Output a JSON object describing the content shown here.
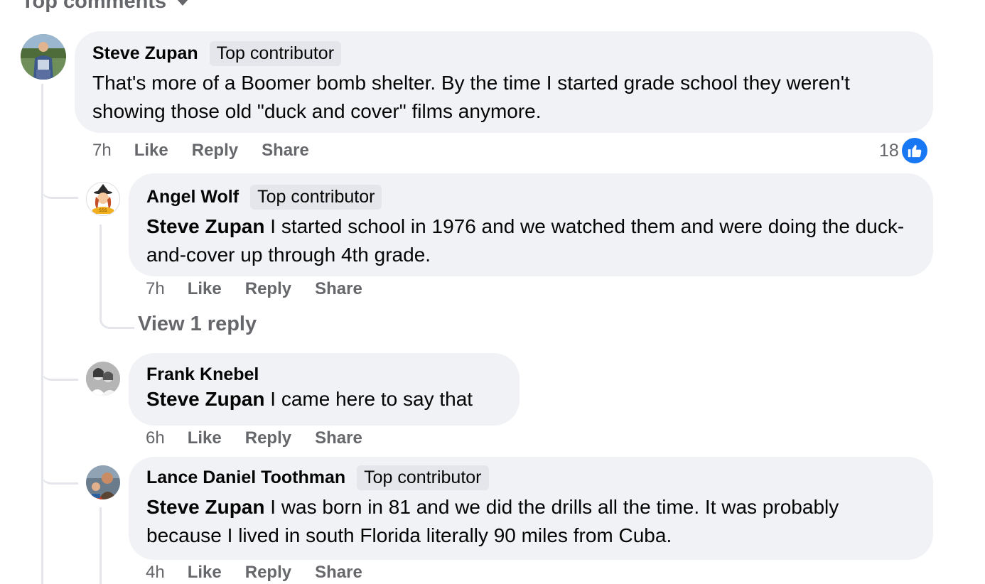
{
  "header": {
    "label": "Top comments"
  },
  "comments": [
    {
      "author": "Steve Zupan",
      "badge": "Top contributor",
      "text": "That's more of a Boomer bomb shelter. By the time I started grade school they weren't showing those old \"duck and cover\" films anymore.",
      "time": "7h",
      "like_label": "Like",
      "reply_label": "Reply",
      "share_label": "Share",
      "reaction_count": "18",
      "avatar_icon": "avatar-photo"
    },
    {
      "author": "Angel Wolf",
      "badge": "Top contributor",
      "mention": "Steve Zupan",
      "text": " I started school in 1976 and we watched them and were doing the duck-and-cover up through 4th grade.",
      "time": "7h",
      "like_label": "Like",
      "reply_label": "Reply",
      "share_label": "Share",
      "view_replies": "View 1 reply"
    },
    {
      "author": "Frank Knebel",
      "mention": "Steve Zupan",
      "text": " I came here to say that",
      "time": "6h",
      "like_label": "Like",
      "reply_label": "Reply",
      "share_label": "Share"
    },
    {
      "author": "Lance Daniel Toothman",
      "badge": "Top contributor",
      "mention": "Steve Zupan",
      "text": " I was born in 81 and we did the drills all the time. It was probably because I lived in south Florida literally 90 miles from Cuba.",
      "time": "4h",
      "like_label": "Like",
      "reply_label": "Reply",
      "share_label": "Share"
    }
  ],
  "colors": {
    "bubble": "#f0f2f5",
    "badge": "#e4e6eb",
    "meta": "#65676b",
    "like_blue": "#1877f2"
  }
}
